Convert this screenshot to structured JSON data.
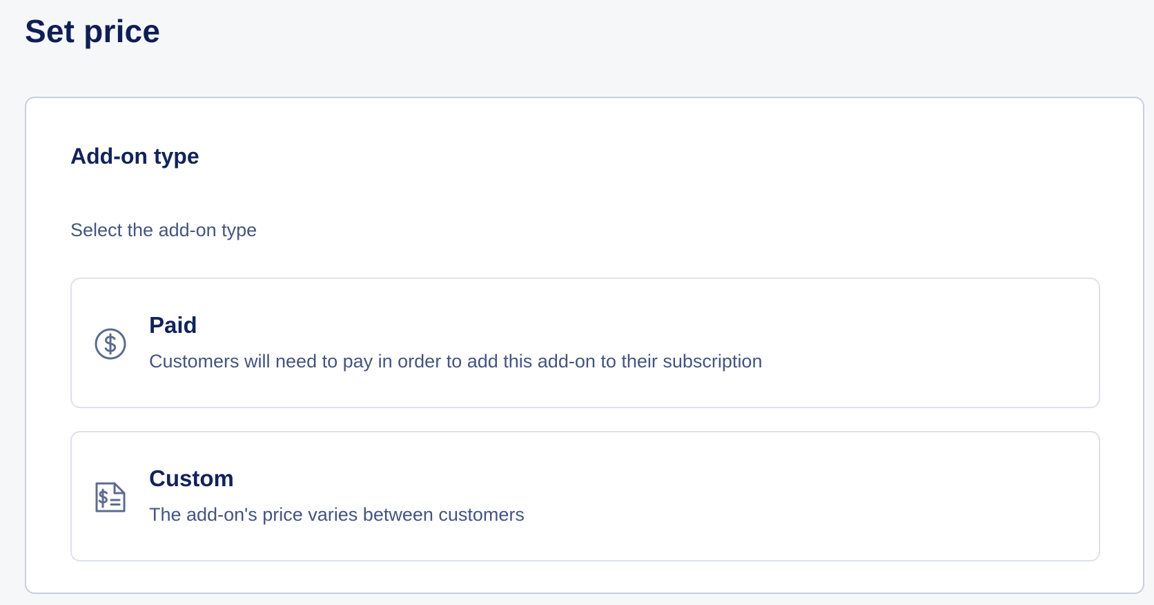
{
  "page": {
    "title": "Set price"
  },
  "addon_type": {
    "heading": "Add-on type",
    "subtitle": "Select the add-on type",
    "options": [
      {
        "title": "Paid",
        "description": "Customers will need to pay in order to add this add-on to their subscription",
        "icon": "dollar-circle-icon"
      },
      {
        "title": "Custom",
        "description": "The add-on's price varies between customers",
        "icon": "price-document-icon"
      }
    ]
  },
  "colors": {
    "primary_text": "#11235a",
    "secondary_text": "#45547f",
    "icon": "#5c6b8f",
    "card_border": "#c7cede",
    "option_border": "#dde1ea",
    "background": "#f6f7f9"
  }
}
